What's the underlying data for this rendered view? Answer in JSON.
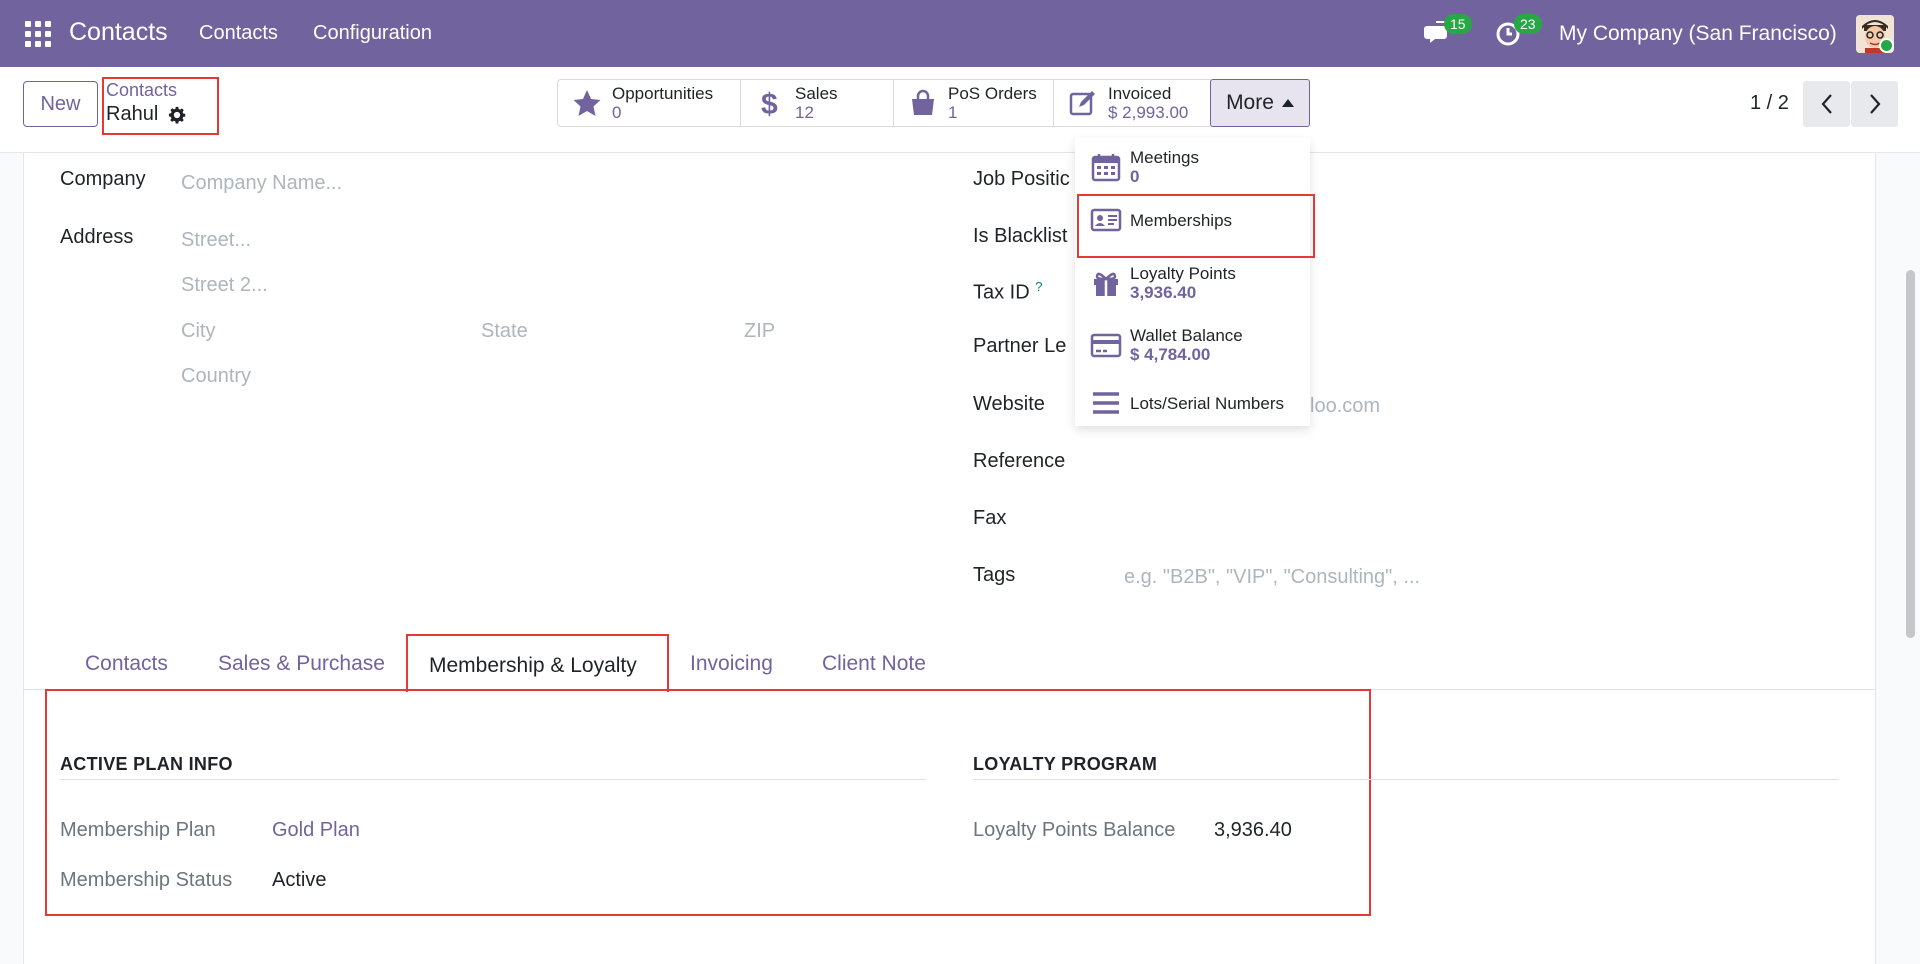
{
  "navbar": {
    "app_name": "Contacts",
    "menu": [
      "Contacts",
      "Configuration"
    ],
    "chat_count": "15",
    "activity_count": "23",
    "company": "My Company (San Francisco)"
  },
  "control": {
    "new_label": "New",
    "breadcrumb_parent": "Contacts",
    "breadcrumb_current": "Rahul",
    "stats": [
      {
        "label": "Opportunities",
        "value": "0"
      },
      {
        "label": "Sales",
        "value": "12"
      },
      {
        "label": "PoS Orders",
        "value": "1"
      },
      {
        "label": "Invoiced",
        "value": "$ 2,993.00"
      }
    ],
    "more_label": "More",
    "pager": "1 / 2"
  },
  "form": {
    "left": {
      "company_label": "Company",
      "company_placeholder": "Company Name...",
      "address_label": "Address",
      "street_placeholder": "Street...",
      "street2_placeholder": "Street 2...",
      "city_placeholder": "City",
      "state_placeholder": "State",
      "zip_placeholder": "ZIP",
      "country_placeholder": "Country"
    },
    "right": {
      "job_label": "Job Positic",
      "blacklist_label": "Is Blacklist",
      "taxid_label": "Tax ID",
      "taxid_help": "?",
      "partner_label": "Partner Le",
      "website_label": "Website",
      "website_placeholder_tail": "loo.com",
      "reference_label": "Reference",
      "fax_label": "Fax",
      "tags_label": "Tags",
      "tags_placeholder": "e.g. \"B2B\", \"VIP\", \"Consulting\", ..."
    }
  },
  "tabs": [
    "Contacts",
    "Sales & Purchase",
    "Membership & Loyalty",
    "Invoicing",
    "Client Note"
  ],
  "membership": {
    "active_plan_title": "ACTIVE PLAN INFO",
    "plan_label": "Membership Plan",
    "plan_value": "Gold Plan",
    "status_label": "Membership Status",
    "status_value": "Active",
    "loyalty_title": "LOYALTY PROGRAM",
    "balance_label": "Loyalty Points Balance",
    "balance_value": "3,936.40"
  },
  "dropdown": {
    "items": [
      {
        "label": "Meetings",
        "value": "0"
      },
      {
        "label": "Memberships",
        "value": ""
      },
      {
        "label": "Loyalty Points",
        "value": "3,936.40"
      },
      {
        "label": "Wallet Balance",
        "value": "$ 4,784.00"
      },
      {
        "label": "Lots/Serial Numbers",
        "value": ""
      }
    ]
  },
  "colors": {
    "brand": "#71639e",
    "highlight": "#e53935",
    "badge": "#28a745"
  }
}
